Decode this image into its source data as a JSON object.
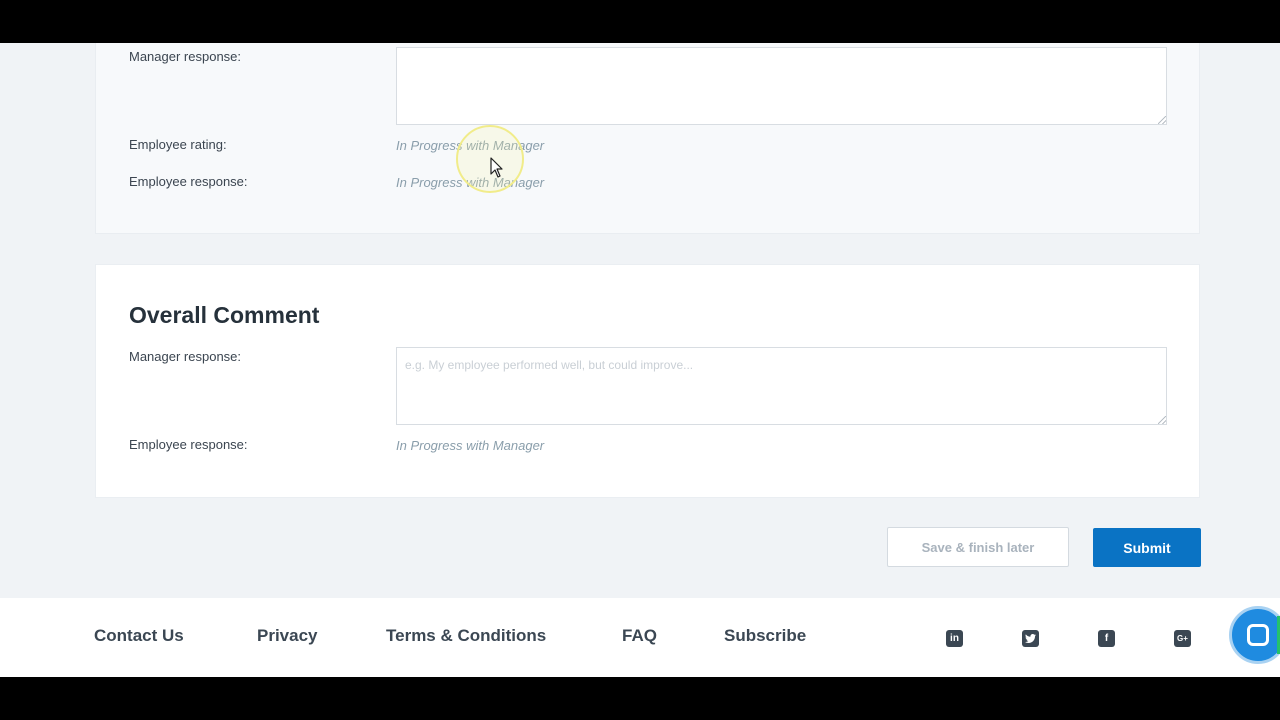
{
  "previous_section": {
    "manager_response_label": "Manager response:",
    "manager_response_value": "",
    "employee_rating_label": "Employee rating:",
    "employee_rating_status": "In Progress with Manager",
    "employee_response_label": "Employee response:",
    "employee_response_status": "In Progress with Manager"
  },
  "overall_comment": {
    "title": "Overall Comment",
    "manager_response_label": "Manager response:",
    "manager_response_value": "",
    "manager_response_placeholder": "e.g. My employee performed well, but could improve...",
    "employee_response_label": "Employee response:",
    "employee_response_status": "In Progress with Manager"
  },
  "actions": {
    "save_label": "Save & finish later",
    "submit_label": "Submit"
  },
  "footer": {
    "links": [
      "Contact Us",
      "Privacy",
      "Terms & Conditions",
      "FAQ",
      "Subscribe"
    ],
    "social": [
      "linkedin-icon",
      "twitter-icon",
      "facebook-icon",
      "google-plus-icon"
    ]
  },
  "colors": {
    "primary": "#0a73c4",
    "status_text": "#8a9eab",
    "page_bg": "#f0f3f6"
  }
}
